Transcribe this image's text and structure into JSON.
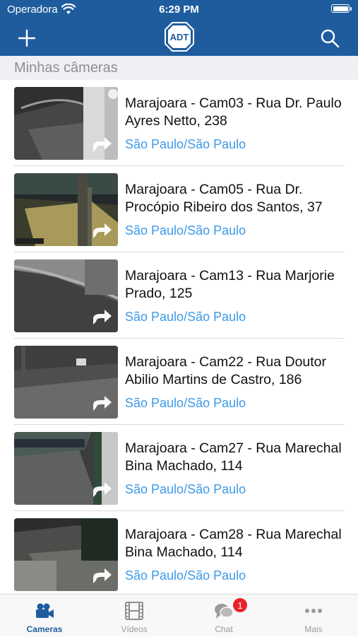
{
  "status_bar": {
    "carrier": "Operadora",
    "time": "6:29 PM"
  },
  "header": {
    "logo_text": "ADT",
    "brand_color": "#1f5c9e"
  },
  "section": {
    "title": "Minhas câmeras"
  },
  "cameras": [
    {
      "title": "Marajoara - Cam03 - Rua Dr. Paulo Ayres Netto, 238",
      "city": "São Paulo/São Paulo"
    },
    {
      "title": "Marajoara - Cam05 - Rua Dr. Procópio Ribeiro dos Santos, 37",
      "city": "São Paulo/São Paulo"
    },
    {
      "title": "Marajoara - Cam13 - Rua Marjorie Prado, 125",
      "city": "São Paulo/São Paulo"
    },
    {
      "title": "Marajoara - Cam22 - Rua Doutor Abilio Martins de Castro, 186",
      "city": "São Paulo/São Paulo"
    },
    {
      "title": "Marajoara - Cam27 - Rua Marechal Bina Machado, 114",
      "city": "São Paulo/São Paulo"
    },
    {
      "title": "Marajoara - Cam28 - Rua Marechal Bina Machado, 114",
      "city": "São Paulo/São Paulo"
    }
  ],
  "tabs": [
    {
      "label": "Cameras",
      "icon": "video-camera-icon",
      "active": true
    },
    {
      "label": "Vídeos",
      "icon": "film-icon",
      "active": false
    },
    {
      "label": "Chat",
      "icon": "chat-bubbles-icon",
      "active": false,
      "badge": "1"
    },
    {
      "label": "Mais",
      "icon": "more-dots-icon",
      "active": false
    }
  ],
  "colors": {
    "accent": "#1f5c9e",
    "link": "#3d9ae8",
    "badge": "#e8222b"
  }
}
